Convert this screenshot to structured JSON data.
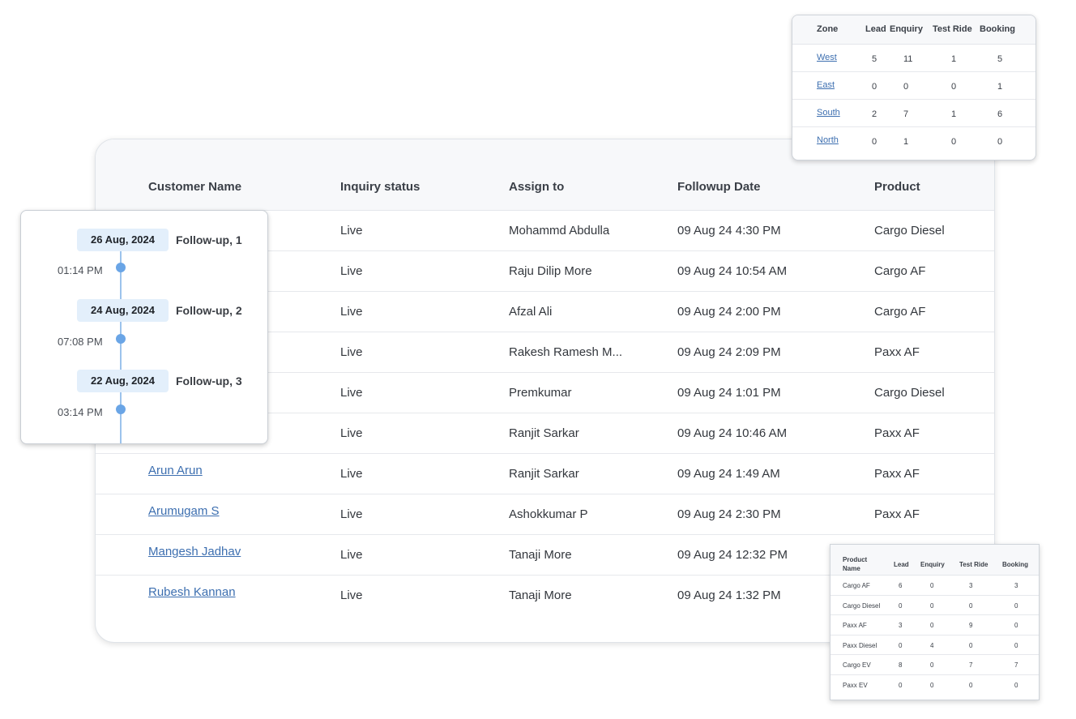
{
  "main_table": {
    "headers": [
      "Customer Name",
      "Inquiry status",
      "Assign to",
      "Followup Date",
      "Product"
    ],
    "rows": [
      {
        "customer": "",
        "status": "Live",
        "assign": "Mohammd Abdulla",
        "date": "09 Aug 24 4:30 PM",
        "product": "Cargo Diesel"
      },
      {
        "customer": "",
        "status": "Live",
        "assign": "Raju Dilip More",
        "date": "09 Aug 24 10:54 AM",
        "product": "Cargo AF"
      },
      {
        "customer": "",
        "status": "Live",
        "assign": "Afzal Ali",
        "date": "09 Aug 24 2:00 PM",
        "product": "Cargo AF"
      },
      {
        "customer": "",
        "status": "Live",
        "assign": "Rakesh Ramesh M...",
        "date": "09 Aug 24 2:09 PM",
        "product": "Paxx AF"
      },
      {
        "customer": "",
        "status": "Live",
        "assign": "Premkumar",
        "date": "09 Aug 24 1:01 PM",
        "product": "Cargo Diesel"
      },
      {
        "customer": "",
        "status": "Live",
        "assign": "Ranjit Sarkar",
        "date": "09 Aug 24 10:46 AM",
        "product": "Paxx AF"
      },
      {
        "customer": "Arun Arun",
        "status": "Live",
        "assign": "Ranjit Sarkar",
        "date": "09 Aug 24 1:49 AM",
        "product": "Paxx AF"
      },
      {
        "customer": "Arumugam S",
        "status": "Live",
        "assign": "Ashokkumar P",
        "date": "09 Aug 24 2:30 PM",
        "product": "Paxx AF"
      },
      {
        "customer": "Mangesh Jadhav",
        "status": "Live",
        "assign": "Tanaji More",
        "date": "09 Aug 24 12:32 PM",
        "product": ""
      },
      {
        "customer": "Rubesh Kannan",
        "status": "Live",
        "assign": "Tanaji More",
        "date": "09 Aug 24 1:32 PM",
        "product": ""
      }
    ]
  },
  "zone_table": {
    "headers": [
      "Zone",
      "Lead",
      "Enquiry",
      "Test Ride",
      "Booking"
    ],
    "rows": [
      {
        "zone": "West",
        "lead": "5",
        "enquiry": "11",
        "test_ride": "1",
        "booking": "5"
      },
      {
        "zone": "East",
        "lead": "0",
        "enquiry": "0",
        "test_ride": "0",
        "booking": "1"
      },
      {
        "zone": "South",
        "lead": "2",
        "enquiry": "7",
        "test_ride": "1",
        "booking": "6"
      },
      {
        "zone": "North",
        "lead": "0",
        "enquiry": "1",
        "test_ride": "0",
        "booking": "0"
      }
    ]
  },
  "product_table": {
    "headers": [
      "Product Name",
      "Lead",
      "Enquiry",
      "Test Ride",
      "Booking"
    ],
    "header_product_line1": "Product",
    "header_product_line2": "Name",
    "rows": [
      {
        "product": "Cargo AF",
        "lead": "6",
        "enquiry": "0",
        "test_ride": "3",
        "booking": "3"
      },
      {
        "product": "Cargo Diesel",
        "lead": "0",
        "enquiry": "0",
        "test_ride": "0",
        "booking": "0"
      },
      {
        "product": "Paxx AF",
        "lead": "3",
        "enquiry": "0",
        "test_ride": "9",
        "booking": "0"
      },
      {
        "product": "Paxx Diesel",
        "lead": "0",
        "enquiry": "4",
        "test_ride": "0",
        "booking": "0"
      },
      {
        "product": "Cargo EV",
        "lead": "8",
        "enquiry": "0",
        "test_ride": "7",
        "booking": "7"
      },
      {
        "product": "Paxx EV",
        "lead": "0",
        "enquiry": "0",
        "test_ride": "0",
        "booking": "0"
      }
    ]
  },
  "timeline": [
    {
      "date": "26 Aug, 2024",
      "label": "Follow-up, 1",
      "time": "01:14 PM"
    },
    {
      "date": "24 Aug, 2024",
      "label": "Follow-up, 2",
      "time": "07:08 PM"
    },
    {
      "date": "22 Aug, 2024",
      "label": "Follow-up, 3",
      "time": "03:14 PM"
    }
  ],
  "colors": {
    "link": "#3d6fb0",
    "timeline_accent": "#6aa5e6",
    "date_chip": "#e3effb",
    "header_bg": "#f7f8fa"
  }
}
